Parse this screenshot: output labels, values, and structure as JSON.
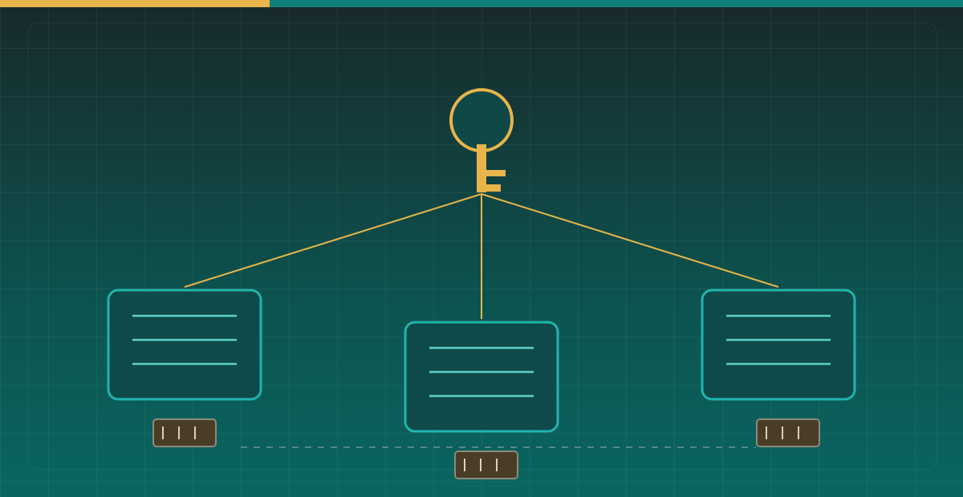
{
  "progress": {
    "fraction": 0.28
  },
  "colors": {
    "accent": "#e7b54a",
    "teal_stroke": "#21b3ad",
    "line_stroke": "#5fd1c8",
    "card_fill": "#0f4a4a",
    "badge_fill": "#4a3d28",
    "badge_stroke": "#8d8a7b",
    "dashed": "#8fa9a6"
  },
  "diagram": {
    "key_icon": "key-icon",
    "documents": [
      {
        "name": "document-left",
        "lines": 3
      },
      {
        "name": "document-center",
        "lines": 3
      },
      {
        "name": "document-right",
        "lines": 3
      }
    ],
    "badges": [
      {
        "name": "badge-left",
        "ticks": 3
      },
      {
        "name": "badge-center",
        "ticks": 3
      },
      {
        "name": "badge-right",
        "ticks": 3
      }
    ]
  }
}
